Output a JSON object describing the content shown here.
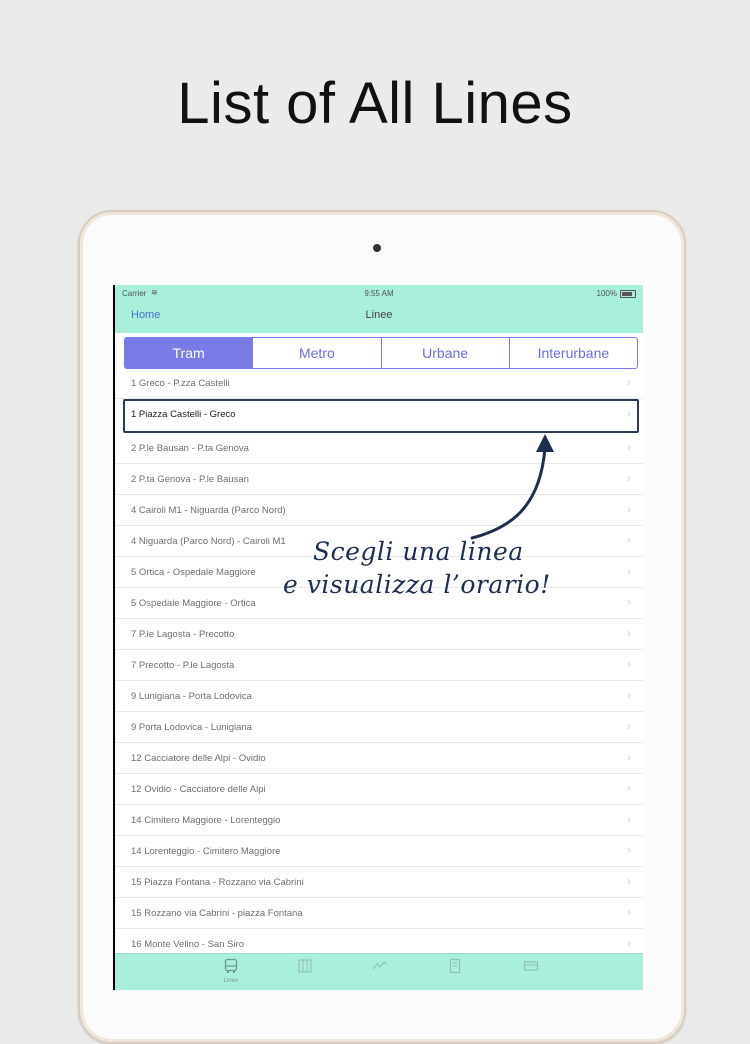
{
  "headline": "List of All Lines",
  "status_bar": {
    "carrier": "Carrier",
    "wifi_icon": "wifi-icon",
    "time": "9:55 AM",
    "battery": "100%"
  },
  "nav": {
    "back": "Home",
    "title": "Linee"
  },
  "segments": {
    "tram": "Tram",
    "metro": "Metro",
    "urbane": "Urbane",
    "interurbane": "Interurbane",
    "selected": "Tram"
  },
  "rows": [
    "1 Greco - P.zza Castelli",
    "1 Piazza Castelli - Greco",
    "2 P.le Bausan - P.ta Genova",
    "2 P.ta Genova - P.le Bausan",
    "4 Cairoli M1 - Niguarda (Parco Nord)",
    "4 Niguarda (Parco Nord) - Cairoli M1",
    "5 Ortica - Ospedale Maggiore",
    "5 Ospedale Maggiore - Ortica",
    "7 P.le Lagosta - Precotto",
    "7 Precotto - P.le Lagosta",
    "9 Lunigiana - Porta Lodovica",
    "9 Porta Lodovica - Lunigiana",
    "12 Cacciatore delle Alpi - Ovidio",
    "12 Ovidio - Cacciatore delle Alpi",
    "14 Cimitero Maggiore - Lorenteggio",
    "14 Lorenteggio - Cimitero Maggiore",
    "15 Piazza Fontana - Rozzano via Cabrini",
    "15 Rozzano via Cabrini - piazza Fontana",
    "16 Monte Velino - San Siro"
  ],
  "selected_row_index": 1,
  "annotation": {
    "line1": "Scegli una linea",
    "line2": "e visualizza l’orario!"
  },
  "tabbar": {
    "linee": "Linee"
  },
  "colors": {
    "nav_bg": "#a8f0dc",
    "accent": "#7b7be8",
    "back_link": "#4a73c7",
    "annotation": "#1d2e4f"
  }
}
